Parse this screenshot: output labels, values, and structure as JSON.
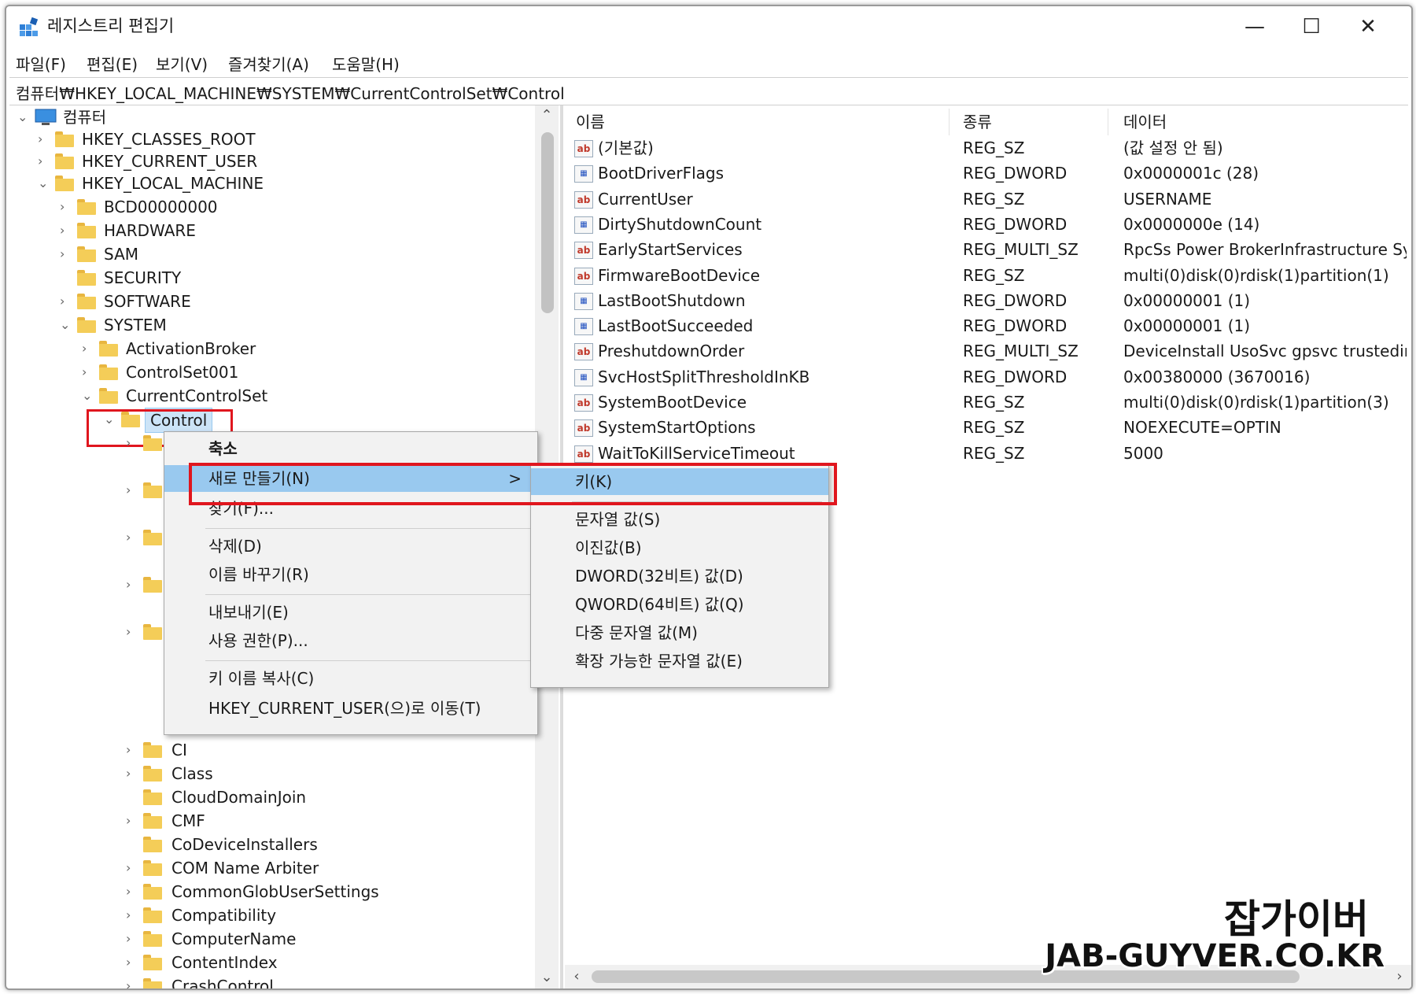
{
  "window": {
    "title": "레지스트리 편집기",
    "controls": {
      "minimize": "—",
      "maximize": "☐",
      "close": "✕"
    }
  },
  "menu": [
    "파일(F)",
    "편집(E)",
    "보기(V)",
    "즐겨찾기(A)",
    "도움말(H)"
  ],
  "address": "컴퓨터₩HKEY_LOCAL_MACHINE₩SYSTEM₩CurrentControlSet₩Control",
  "tree": {
    "root": "컴퓨터",
    "hives": [
      "HKEY_CLASSES_ROOT",
      "HKEY_CURRENT_USER",
      "HKEY_LOCAL_MACHINE"
    ],
    "hklm_children": [
      "BCD00000000",
      "HARDWARE",
      "SAM",
      "SECURITY",
      "SOFTWARE",
      "SYSTEM"
    ],
    "system_children": [
      "ActivationBroker",
      "ControlSet001",
      "CurrentControlSet"
    ],
    "selected": "Control",
    "control_children_visible": [
      "CI",
      "Class",
      "CloudDomainJoin",
      "CMF",
      "CoDeviceInstallers",
      "COM Name Arbiter",
      "CommonGlobUserSettings",
      "Compatibility",
      "ComputerName",
      "ContentIndex",
      "CrashControl"
    ]
  },
  "list": {
    "headers": {
      "name": "이름",
      "type": "종류",
      "data": "데이터"
    },
    "rows": [
      {
        "icon": "string-value-icon",
        "name": "(기본값)",
        "type": "REG_SZ",
        "data": "(값 설정 안 됨)"
      },
      {
        "icon": "binary-value-icon",
        "name": "BootDriverFlags",
        "type": "REG_DWORD",
        "data": "0x0000001c (28)"
      },
      {
        "icon": "string-value-icon",
        "name": "CurrentUser",
        "type": "REG_SZ",
        "data": "USERNAME"
      },
      {
        "icon": "binary-value-icon",
        "name": "DirtyShutdownCount",
        "type": "REG_DWORD",
        "data": "0x0000000e (14)"
      },
      {
        "icon": "string-value-icon",
        "name": "EarlyStartServices",
        "type": "REG_MULTI_SZ",
        "data": "RpcSs Power BrokerInfrastructure System"
      },
      {
        "icon": "string-value-icon",
        "name": "FirmwareBootDevice",
        "type": "REG_SZ",
        "data": "multi(0)disk(0)rdisk(1)partition(1)"
      },
      {
        "icon": "binary-value-icon",
        "name": "LastBootShutdown",
        "type": "REG_DWORD",
        "data": "0x00000001 (1)"
      },
      {
        "icon": "binary-value-icon",
        "name": "LastBootSucceeded",
        "type": "REG_DWORD",
        "data": "0x00000001 (1)"
      },
      {
        "icon": "string-value-icon",
        "name": "PreshutdownOrder",
        "type": "REG_MULTI_SZ",
        "data": "DeviceInstall UsoSvc gpsvc trustedinstall"
      },
      {
        "icon": "binary-value-icon",
        "name": "SvcHostSplitThresholdInKB",
        "type": "REG_DWORD",
        "data": "0x00380000 (3670016)"
      },
      {
        "icon": "string-value-icon",
        "name": "SystemBootDevice",
        "type": "REG_SZ",
        "data": "multi(0)disk(0)rdisk(1)partition(3)"
      },
      {
        "icon": "string-value-icon",
        "name": "SystemStartOptions",
        "type": "REG_SZ",
        "data": " NOEXECUTE=OPTIN"
      },
      {
        "icon": "string-value-icon",
        "name": "WaitToKillServiceTimeout",
        "type": "REG_SZ",
        "data": "5000"
      }
    ]
  },
  "context_menu": {
    "items": [
      "축소",
      "새로 만들기(N)",
      "찾기(F)...",
      "삭제(D)",
      "이름 바꾸기(R)",
      "내보내기(E)",
      "사용 권한(P)...",
      "키 이름 복사(C)",
      "HKEY_CURRENT_USER(으)로 이동(T)"
    ],
    "submenu_arrow": ">"
  },
  "submenu": {
    "items": [
      "키(K)",
      "문자열 값(S)",
      "이진값(B)",
      "DWORD(32비트) 값(D)",
      "QWORD(64비트) 값(Q)",
      "다중 문자열 값(M)",
      "확장 가능한 문자열 값(E)"
    ]
  },
  "icons": {
    "string_value": "ab",
    "binary_value": "01\n10"
  },
  "watermark": {
    "line1": "잡가이버",
    "line2": "JAB-GUYVER.CO.KR"
  },
  "colors": {
    "highlight": "#99c9ef",
    "annotation": "#e0161e",
    "folder": "#f4cd58"
  }
}
